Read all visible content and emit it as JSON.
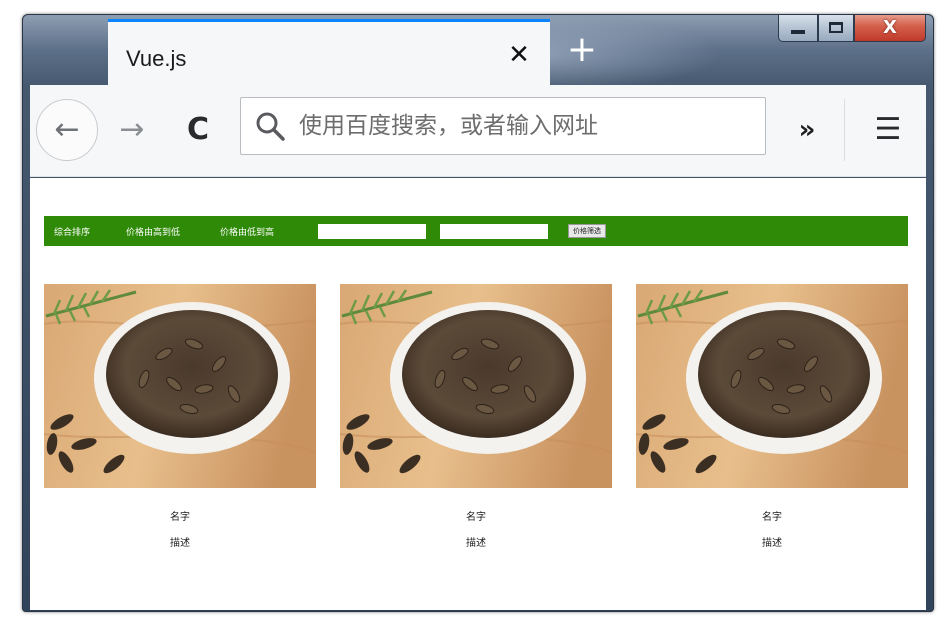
{
  "browser": {
    "tab_title": "Vue.js",
    "tab_close": "✕",
    "new_tab": "+",
    "url_placeholder": "使用百度搜索，或者输入网址",
    "back": "←",
    "forward": "→",
    "reload": "C",
    "overflow": "»",
    "menu": "☰",
    "window_close": "X"
  },
  "toolbar": {
    "sort_default": "综合排序",
    "sort_price_desc": "价格由高到低",
    "sort_price_asc": "价格由低到高",
    "range_separator": "-",
    "filter_button": "价格筛选"
  },
  "products": [
    {
      "name": "名字",
      "description": "描述"
    },
    {
      "name": "名字",
      "description": "描述"
    },
    {
      "name": "名字",
      "description": "描述"
    }
  ],
  "colors": {
    "toolbar_green": "#2e8a07",
    "tab_accent": "#0a84ff",
    "window_close_red": "#c0392b"
  }
}
